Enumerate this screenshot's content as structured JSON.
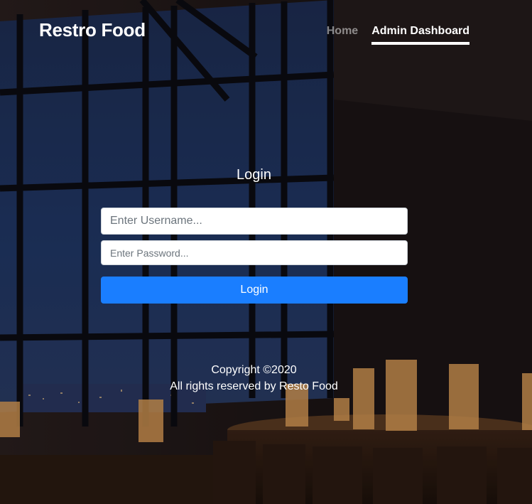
{
  "brand": {
    "name": "Restro Food"
  },
  "nav": {
    "items": [
      {
        "label": "Home",
        "active": false
      },
      {
        "label": "Admin Dashboard",
        "active": true
      }
    ]
  },
  "login": {
    "title": "Login",
    "username_placeholder": "Enter Username...",
    "username_value": "",
    "password_placeholder": "Enter Password...",
    "password_value": "",
    "button_label": "Login"
  },
  "footer": {
    "copyright": "Copyright ©2020",
    "rights": "All rights reserved by Resto Food"
  },
  "colors": {
    "primary_button": "#1a7eff",
    "text": "#ffffff",
    "nav_inactive": "rgba(255,255,255,0.5)"
  }
}
